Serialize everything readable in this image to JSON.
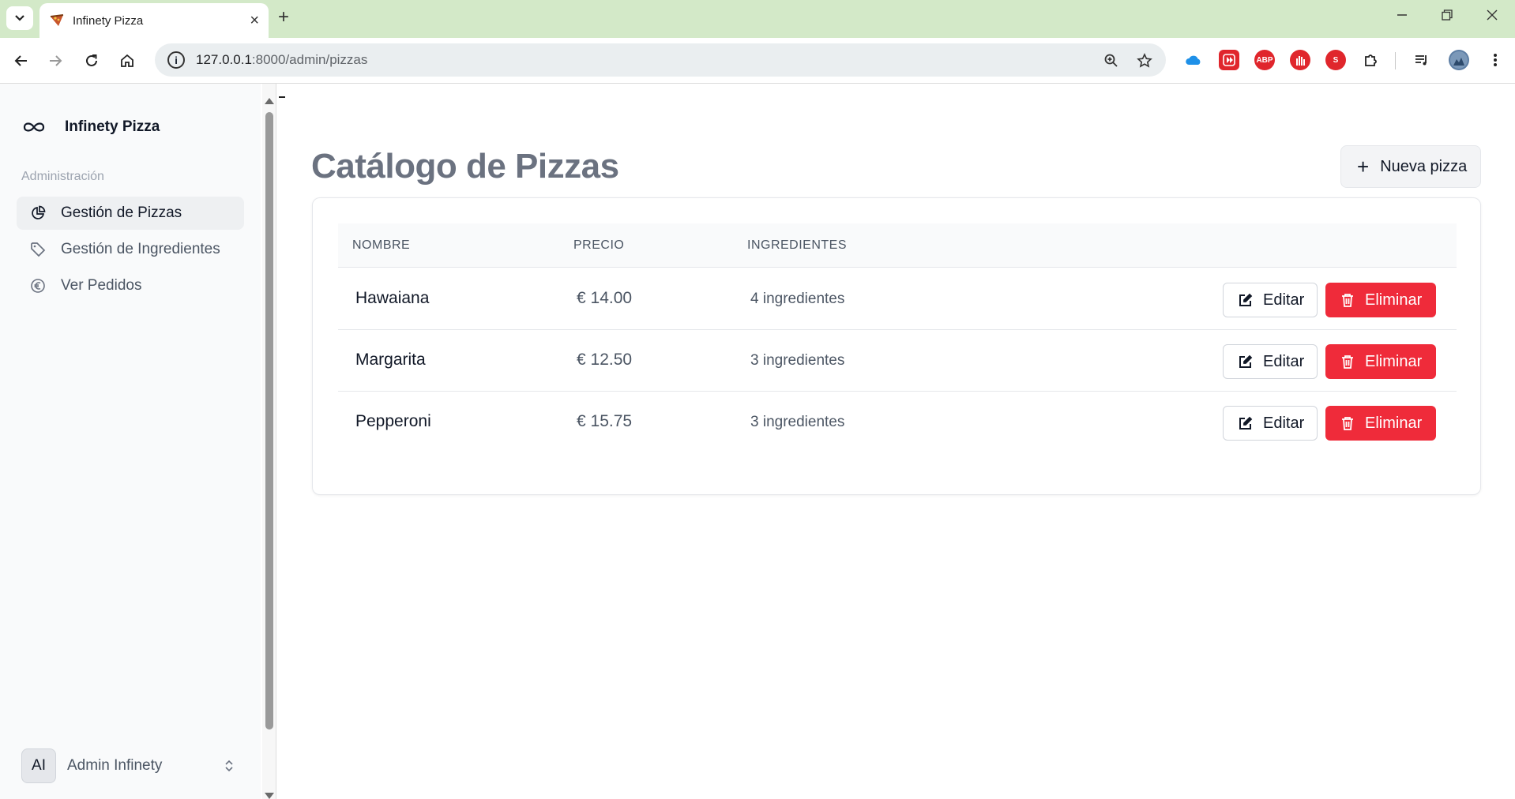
{
  "browser": {
    "tab_title": "Infinety Pizza",
    "url_host": "127.0.0.1",
    "url_path": ":8000/admin/pizzas",
    "extensions": [
      "onedrive-icon",
      "video-speed-icon",
      "adblock-plus-icon",
      "ublock-icon",
      "security-extension-icon",
      "puzzle-icon"
    ],
    "colors": {
      "tabbar": "#d3e9c8"
    }
  },
  "sidebar": {
    "brand": "Infinety Pizza",
    "section": "Administración",
    "items": [
      {
        "label": "Gestión de Pizzas",
        "icon": "pie-chart-icon",
        "active": true
      },
      {
        "label": "Gestión de Ingredientes",
        "icon": "tag-icon",
        "active": false
      },
      {
        "label": "Ver Pedidos",
        "icon": "euro-icon",
        "active": false
      }
    ],
    "user": {
      "initials": "AI",
      "name": "Admin Infinety"
    }
  },
  "main": {
    "title": "Catálogo de Pizzas",
    "new_button": "Nueva pizza",
    "columns": [
      "NOMBRE",
      "PRECIO",
      "INGREDIENTES"
    ],
    "rows": [
      {
        "name": "Hawaiana",
        "price": "€ 14.00",
        "ingredients": "4 ingredientes"
      },
      {
        "name": "Margarita",
        "price": "€ 12.50",
        "ingredients": "3 ingredientes"
      },
      {
        "name": "Pepperoni",
        "price": "€ 15.75",
        "ingredients": "3 ingredientes"
      }
    ],
    "edit_label": "Editar",
    "delete_label": "Eliminar",
    "colors": {
      "delete": "#ef2b3a"
    }
  }
}
